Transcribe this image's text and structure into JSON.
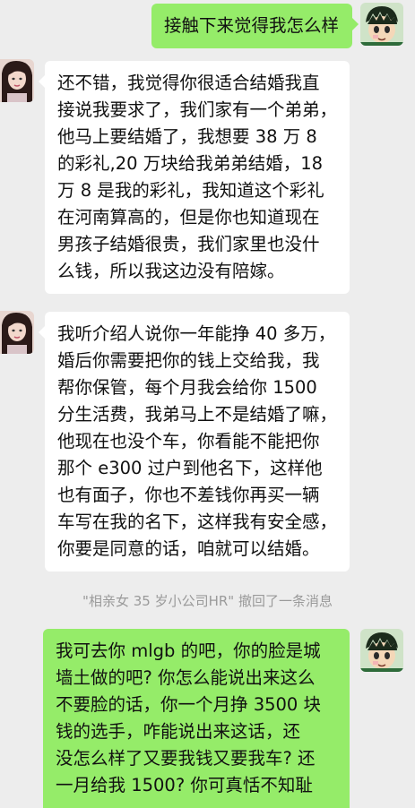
{
  "messages": [
    {
      "side": "right",
      "lines": [
        "接触下来觉得我怎么样"
      ]
    },
    {
      "side": "left",
      "lines": [
        "还不错，我觉得你很适合结婚我直",
        "接说我要求了，我们家有一个弟弟，",
        "他马上要结婚了，我想要 38 万 8",
        "的彩礼,20 万块给我弟弟结婚，18",
        "万 8 是我的彩礼，我知道这个彩礼",
        "在河南算高的，但是你也知道现在",
        "男孩子结婚很贵，我们家里也没什",
        "么钱，所以我这边没有陪嫁。"
      ]
    },
    {
      "side": "left",
      "lines": [
        "我听介绍人说你一年能挣 40 多万，",
        "婚后你需要把你的钱上交给我，我",
        "帮你保管，每个月我会给你 1500",
        "分生活费，我弟马上不是结婚了嘛，",
        "他现在也没个车，你看能不能把你",
        "那个 e300 过户到他名下，这样他",
        "也有面子，你也不差钱你再买一辆",
        "车写在我的名下，这样我有安全感，",
        "你要是同意的话，咱就可以结婚。"
      ]
    },
    {
      "side": "right",
      "lines": [
        "我可去你 mlgb 的吧，你的脸是城",
        "墙土做的吧? 你怎么能说出来这么",
        "不要脸的话，你一个月挣 3500 块",
        "钱的选手，咋能说出来这话，还",
        "没怎么样了又要我钱又要我车? 还",
        "一月给我 1500? 你可真恬不知耻"
      ]
    }
  ],
  "recall_notice": "\"相亲女 35 岁小公司HR\" 撤回了一条消息",
  "colors": {
    "background": "#ededed",
    "bubble_self": "#95ec69",
    "bubble_other": "#ffffff",
    "notice_text": "#9a9a9a"
  }
}
